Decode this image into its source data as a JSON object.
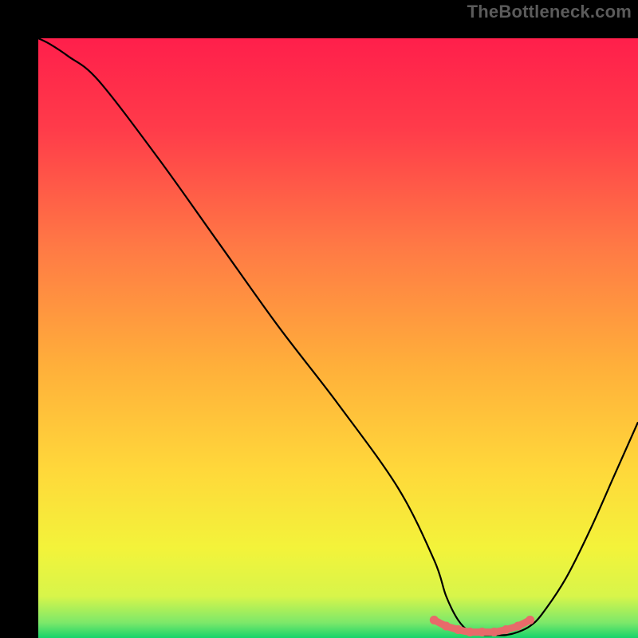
{
  "watermark": "TheBottleneck.com",
  "chart_data": {
    "type": "line",
    "title": "",
    "xlabel": "",
    "ylabel": "",
    "xlim": [
      0,
      100
    ],
    "ylim": [
      0,
      100
    ],
    "grid": false,
    "legend": false,
    "series": [
      {
        "name": "bottleneck-curve",
        "x": [
          0,
          2,
          5,
          10,
          20,
          30,
          40,
          50,
          60,
          66,
          68,
          70,
          72,
          74,
          76,
          78,
          80,
          82,
          84,
          88,
          92,
          96,
          100
        ],
        "y": [
          100,
          99,
          97,
          93,
          80,
          66,
          52,
          39,
          25,
          13,
          7,
          3,
          1,
          0.5,
          0.5,
          0.5,
          1,
          2,
          4,
          10,
          18,
          27,
          36
        ]
      }
    ],
    "highlight_segment": {
      "name": "flat-minimum",
      "x": [
        66,
        68,
        70,
        72,
        74,
        76,
        78,
        80,
        82
      ],
      "y": [
        3.0,
        2.0,
        1.4,
        1.0,
        1.0,
        1.0,
        1.4,
        2.0,
        3.0
      ]
    },
    "background_gradient_stops": [
      {
        "offset": 0.0,
        "color": "#ff1f4b"
      },
      {
        "offset": 0.15,
        "color": "#ff3b4a"
      },
      {
        "offset": 0.35,
        "color": "#ff7a45"
      },
      {
        "offset": 0.55,
        "color": "#ffb03a"
      },
      {
        "offset": 0.72,
        "color": "#ffd83a"
      },
      {
        "offset": 0.85,
        "color": "#f3f33a"
      },
      {
        "offset": 0.93,
        "color": "#d8f54a"
      },
      {
        "offset": 0.975,
        "color": "#7be86a"
      },
      {
        "offset": 1.0,
        "color": "#17d36b"
      }
    ]
  }
}
